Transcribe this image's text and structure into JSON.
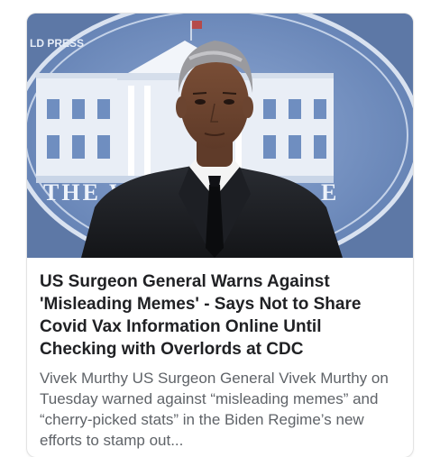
{
  "article": {
    "image_watermark": "LD PRESS",
    "image_backdrop_text": "THE W",
    "image_backdrop_text_right": "E",
    "headline": "US Surgeon General Warns Against 'Misleading Memes' - Says Not to Share Covid Vax Information Online Until Checking with Overlords at CDC",
    "snippet": "Vivek Murthy US Surgeon General Vivek Murthy on Tuesday warned against “misleading memes” and “cherry-picked stats” in the Biden Regime’s new efforts to stamp out..."
  },
  "colors": {
    "headline": "#202124",
    "snippet": "#5f6368",
    "backdrop_blue": "#6f8ec0"
  }
}
